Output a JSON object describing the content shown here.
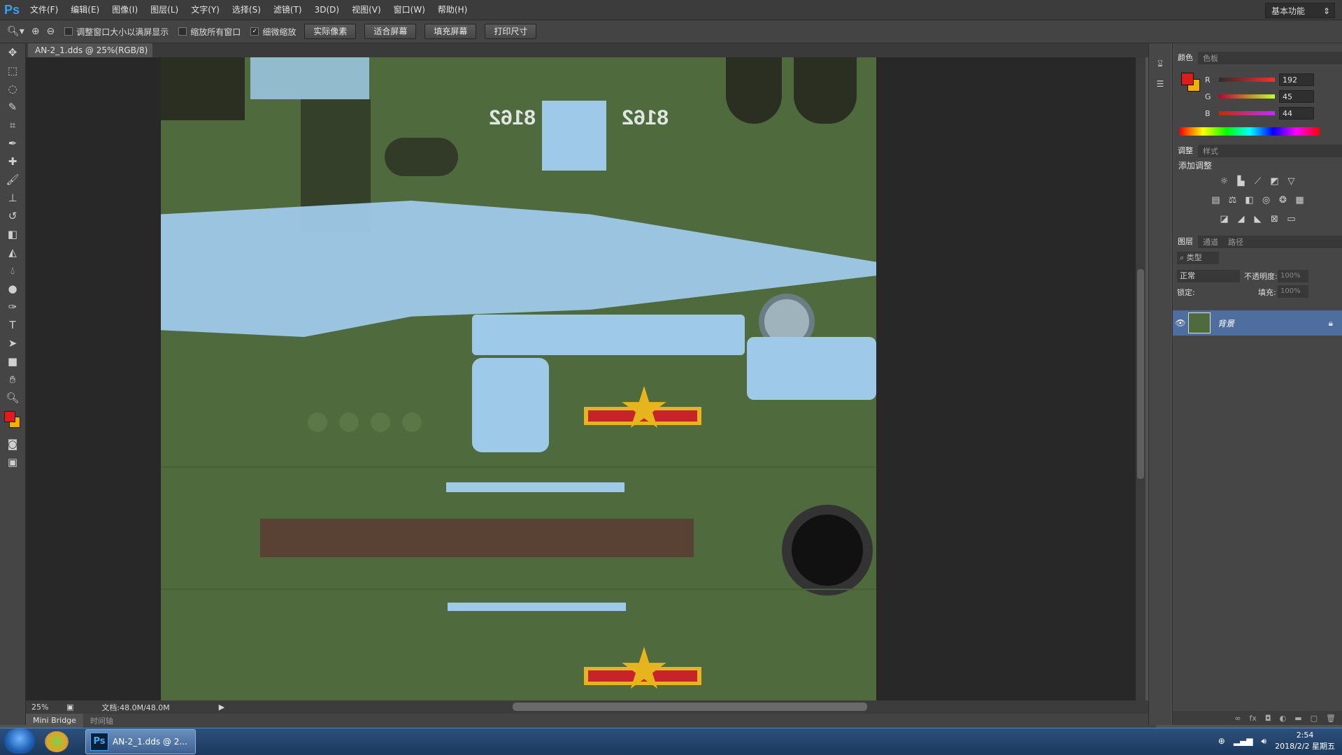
{
  "app": {
    "logo": "Ps"
  },
  "menu": [
    "文件(F)",
    "编辑(E)",
    "图像(I)",
    "图层(L)",
    "文字(Y)",
    "选择(S)",
    "滤镜(T)",
    "3D(D)",
    "视图(V)",
    "窗口(W)",
    "帮助(H)"
  ],
  "options": {
    "resize_windows_label": "调整窗口大小以满屏显示",
    "zoom_all_label": "缩放所有窗口",
    "scrubby_zoom_label": "细微缩放",
    "scrubby_zoom_checked": true,
    "btn_actual": "实际像素",
    "btn_fit": "适合屏幕",
    "btn_fill": "填充屏幕",
    "btn_print": "打印尺寸",
    "workspace": "基本功能"
  },
  "document": {
    "tab": "AN-2_1.dds @ 25%(RGB/8)"
  },
  "canvas": {
    "mirrored_text": "8162",
    "colors": {
      "base": "#4f6a3c",
      "skin": "#9ec9e8",
      "insignia_red": "#c8232a",
      "insignia_yellow": "#e6b51e"
    }
  },
  "status": {
    "zoom": "25%",
    "doc": "文档:48.0M/48.0M"
  },
  "bottom_tabs": {
    "mini_bridge": "Mini Bridge",
    "timeline": "时间轴"
  },
  "color_panel": {
    "tabs": [
      "颜色",
      "色板"
    ],
    "fg_color": "#e01b1b",
    "bg_color": "#f0b000",
    "R": {
      "label": "R",
      "value": "192"
    },
    "G": {
      "label": "G",
      "value": "45"
    },
    "B": {
      "label": "B",
      "value": "44"
    }
  },
  "adjust_panel": {
    "tabs": [
      "调整",
      "样式"
    ],
    "title": "添加调整"
  },
  "layers_panel": {
    "tabs": [
      "图层",
      "通道",
      "路径"
    ],
    "filter": "类型",
    "blend_mode": "正常",
    "opacity_label": "不透明度:",
    "opacity_value": "100%",
    "lock_label": "锁定:",
    "fill_label": "填充:",
    "fill_value": "100%",
    "layer_name": "背景"
  },
  "taskbar": {
    "task_label": "AN-2_1.dds @ 2...",
    "time": "2:54",
    "date": "2018/2/2 星期五"
  }
}
